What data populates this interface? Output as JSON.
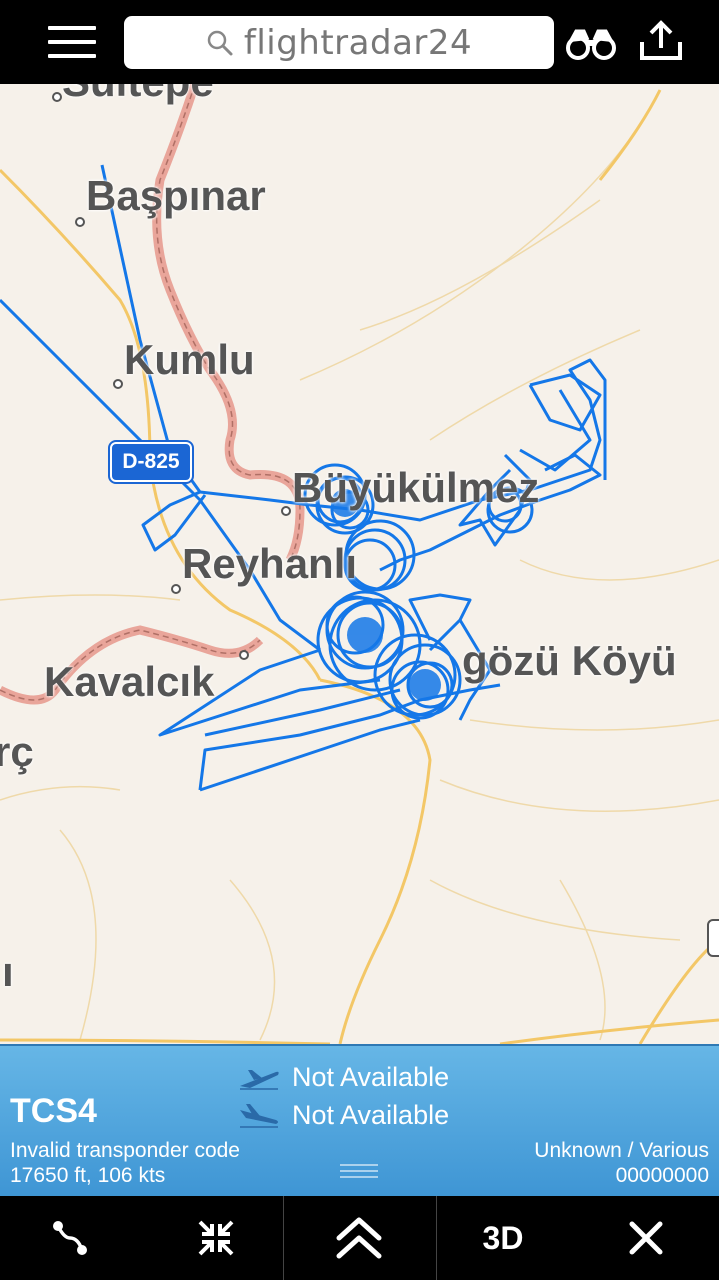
{
  "header": {
    "search_text": "flightradar24",
    "menu_icon": "hamburger-menu-icon",
    "binoculars_icon": "binoculars-icon",
    "share_icon": "share-icon"
  },
  "map": {
    "labels": {
      "sultepe": "Sultepe",
      "baspinar": "Başpınar",
      "kumlu": "Kumlu",
      "reyhanli": "Reyhanlı",
      "bukulmez": "Büyükülmez",
      "kavalcik": "Kavalcık",
      "gozu_koyu": "gözü Köyü",
      "arc": "rç",
      "edge_i": "ı"
    },
    "road_badge": "D-825",
    "colors": {
      "track": "#1477e8",
      "border": "#e9a59a",
      "road": "#f3c767",
      "background": "#f6f1ea"
    }
  },
  "flight": {
    "callsign": "TCS4",
    "departure": "Not Available",
    "arrival": "Not Available",
    "squawk": "Invalid transponder code",
    "altitude_speed": "17650 ft, 106 kts",
    "aircraft": "Unknown / Various",
    "registration": "00000000"
  },
  "toolbar": {
    "route_icon": "route-icon",
    "collapse_icon": "collapse-icon",
    "expand_icon": "chevron-up-double-icon",
    "label_3d": "3D",
    "close_icon": "close-icon"
  }
}
